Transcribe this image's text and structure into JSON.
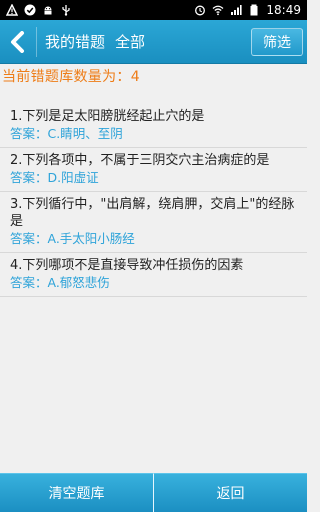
{
  "status_bar": {
    "time": "18:49",
    "left_icons": [
      "warning-icon",
      "check-circle-icon",
      "android-icon",
      "usb-icon"
    ],
    "right_icons": [
      "alarm-icon",
      "wifi-icon",
      "signal-icon",
      "battery-icon"
    ]
  },
  "header": {
    "title": "我的错题",
    "filter_scope": "全部",
    "filter_button": "筛选"
  },
  "count_line": "当前错题库数量为：4",
  "questions": [
    {
      "text": "1.下列是足太阳膀胱经起止穴的是",
      "answer": "答案：C.睛明、至阴"
    },
    {
      "text": "2.下列各项中，不属于三阴交穴主治病症的是",
      "answer": "答案：D.阳虚证"
    },
    {
      "text": "3.下列循行中，\"出肩解，绕肩胛，交肩上\"的经脉是",
      "answer": "答案：A.手太阳小肠经"
    },
    {
      "text": "4.下列哪项不是直接导致冲任损伤的因素",
      "answer": "答案：A.郁怒悲伤"
    }
  ],
  "bottom": {
    "clear_button": "清空题库",
    "back_button": "返回"
  },
  "colors": {
    "accent": "#1a8fc0",
    "count_text": "#ee7d18",
    "answer_text": "#2ea3d9"
  }
}
